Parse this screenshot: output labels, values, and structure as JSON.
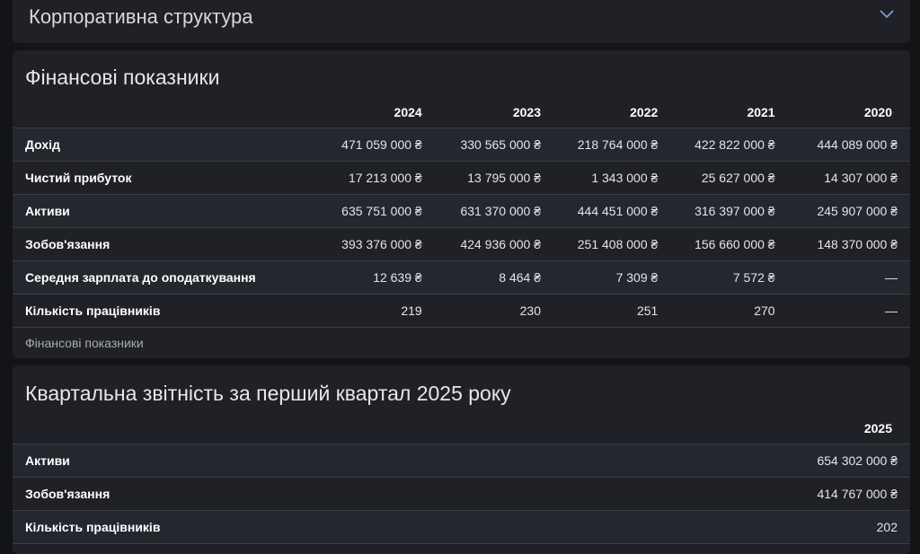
{
  "corporate": {
    "title": "Корпоративна структура",
    "toggle_icon": "chevron-down-icon"
  },
  "financial": {
    "title": "Фінансові показники",
    "years": [
      "2024",
      "2023",
      "2022",
      "2021",
      "2020"
    ],
    "rows": [
      {
        "label": "Дохід",
        "values": [
          "471 059 000 ₴",
          "330 565 000 ₴",
          "218 764 000 ₴",
          "422 822 000 ₴",
          "444 089 000 ₴"
        ]
      },
      {
        "label": "Чистий прибуток",
        "values": [
          "17 213 000 ₴",
          "13 795 000 ₴",
          "1 343 000 ₴",
          "25 627 000 ₴",
          "14 307 000 ₴"
        ]
      },
      {
        "label": "Активи",
        "values": [
          "635 751 000 ₴",
          "631 370 000 ₴",
          "444 451 000 ₴",
          "316 397 000 ₴",
          "245 907 000 ₴"
        ]
      },
      {
        "label": "Зобов'язання",
        "values": [
          "393 376 000 ₴",
          "424 936 000 ₴",
          "251 408 000 ₴",
          "156 660 000 ₴",
          "148 370 000 ₴"
        ]
      },
      {
        "label": "Середня зарплата до оподаткування",
        "values": [
          "12 639 ₴",
          "8 464 ₴",
          "7 309 ₴",
          "7 572 ₴",
          "—"
        ]
      },
      {
        "label": "Кількість працівників",
        "values": [
          "219",
          "230",
          "251",
          "270",
          "—"
        ]
      }
    ],
    "caption": "Фінансові показники"
  },
  "quarterly": {
    "title": "Квартальна звітність за перший квартал 2025 року",
    "years": [
      "2025"
    ],
    "rows": [
      {
        "label": "Активи",
        "values": [
          "654 302 000 ₴"
        ]
      },
      {
        "label": "Зобов'язання",
        "values": [
          "414 767 000 ₴"
        ]
      },
      {
        "label": "Кількість працівників",
        "values": [
          "202"
        ]
      }
    ]
  }
}
